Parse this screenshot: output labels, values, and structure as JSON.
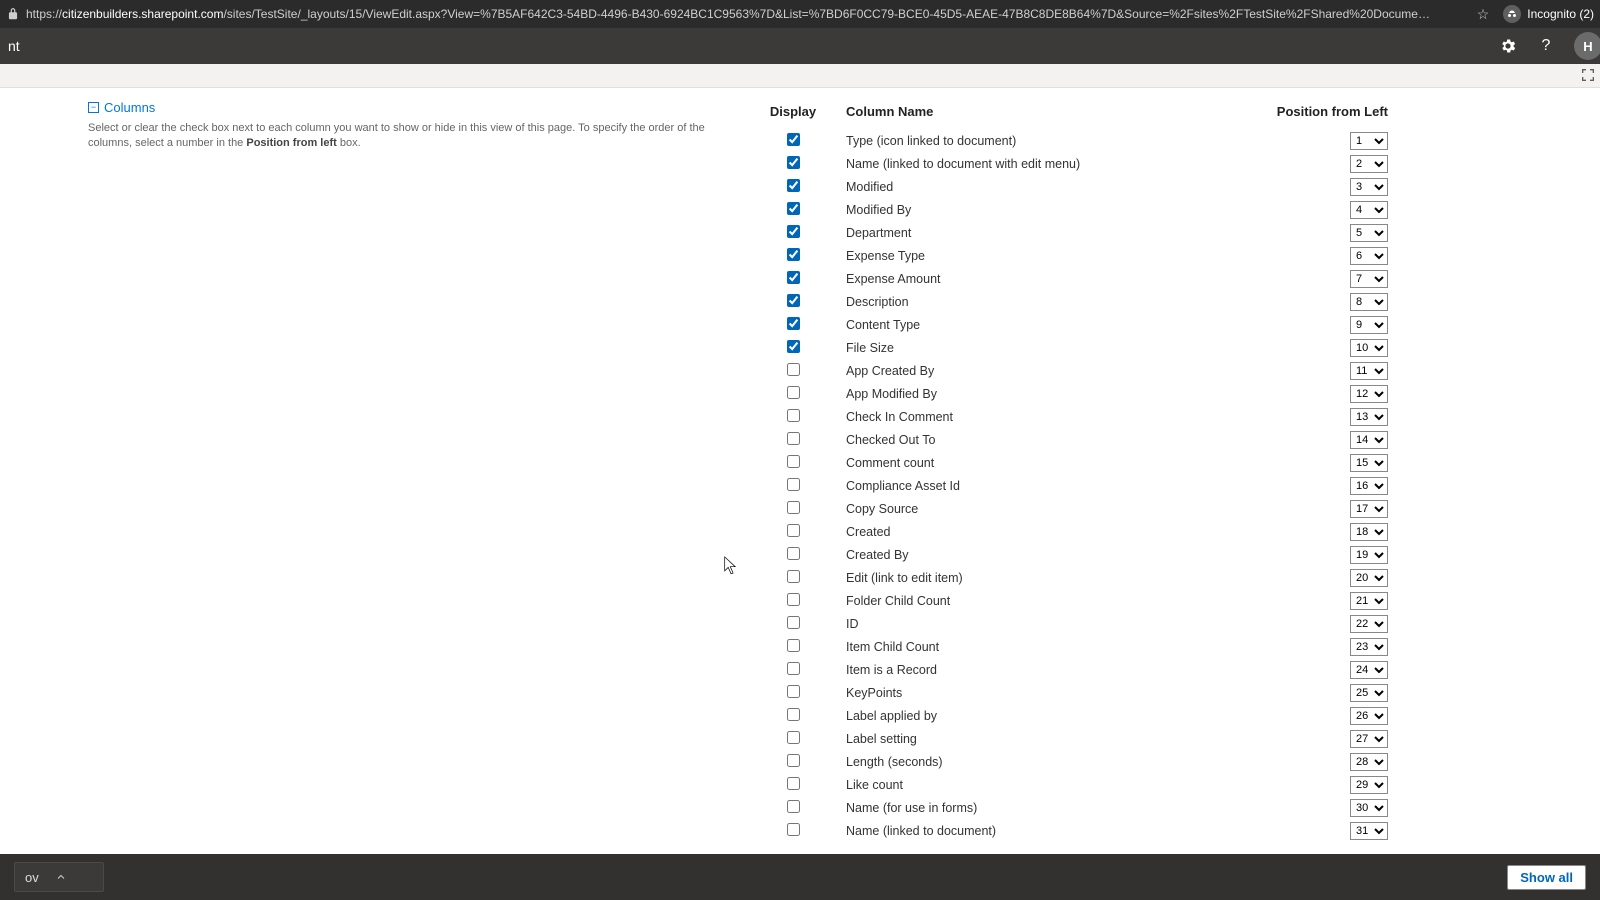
{
  "browser": {
    "url_prefix": "https://",
    "url_host": "citizenbuilders.sharepoint.com",
    "url_path": "/sites/TestSite/_layouts/15/ViewEdit.aspx?View=%7B5AF642C3-54BD-4496-B430-6924BC1C9563%7D&List=%7BD6F0CC79-BCE0-45D5-AEAE-47B8C8DE8B64%7D&Source=%2Fsites%2FTestSite%2FShared%20Docume…",
    "incognito_label": "Incognito (2)"
  },
  "suite": {
    "title_fragment": "nt",
    "avatar_initial": "H"
  },
  "section": {
    "title": "Columns",
    "desc_a": "Select or clear the check box next to each column you want to show or hide in this view of this page. To specify the order of the columns, select a number in the ",
    "desc_bold": "Position from left",
    "desc_b": " box."
  },
  "headers": {
    "display": "Display",
    "name": "Column Name",
    "position": "Position from Left"
  },
  "columns": [
    {
      "checked": true,
      "name": "Type (icon linked to document)",
      "pos": "1"
    },
    {
      "checked": true,
      "name": "Name (linked to document with edit menu)",
      "pos": "2"
    },
    {
      "checked": true,
      "name": "Modified",
      "pos": "3"
    },
    {
      "checked": true,
      "name": "Modified By",
      "pos": "4"
    },
    {
      "checked": true,
      "name": "Department",
      "pos": "5"
    },
    {
      "checked": true,
      "name": "Expense Type",
      "pos": "6"
    },
    {
      "checked": true,
      "name": "Expense Amount",
      "pos": "7"
    },
    {
      "checked": true,
      "name": "Description",
      "pos": "8"
    },
    {
      "checked": true,
      "name": "Content Type",
      "pos": "9"
    },
    {
      "checked": true,
      "name": "File Size",
      "pos": "10"
    },
    {
      "checked": false,
      "name": "App Created By",
      "pos": "11"
    },
    {
      "checked": false,
      "name": "App Modified By",
      "pos": "12"
    },
    {
      "checked": false,
      "name": "Check In Comment",
      "pos": "13"
    },
    {
      "checked": false,
      "name": "Checked Out To",
      "pos": "14"
    },
    {
      "checked": false,
      "name": "Comment count",
      "pos": "15"
    },
    {
      "checked": false,
      "name": "Compliance Asset Id",
      "pos": "16"
    },
    {
      "checked": false,
      "name": "Copy Source",
      "pos": "17"
    },
    {
      "checked": false,
      "name": "Created",
      "pos": "18"
    },
    {
      "checked": false,
      "name": "Created By",
      "pos": "19"
    },
    {
      "checked": false,
      "name": "Edit (link to edit item)",
      "pos": "20"
    },
    {
      "checked": false,
      "name": "Folder Child Count",
      "pos": "21"
    },
    {
      "checked": false,
      "name": "ID",
      "pos": "22"
    },
    {
      "checked": false,
      "name": "Item Child Count",
      "pos": "23"
    },
    {
      "checked": false,
      "name": "Item is a Record",
      "pos": "24"
    },
    {
      "checked": false,
      "name": "KeyPoints",
      "pos": "25"
    },
    {
      "checked": false,
      "name": "Label applied by",
      "pos": "26"
    },
    {
      "checked": false,
      "name": "Label setting",
      "pos": "27"
    },
    {
      "checked": false,
      "name": "Length (seconds)",
      "pos": "28"
    },
    {
      "checked": false,
      "name": "Like count",
      "pos": "29"
    },
    {
      "checked": false,
      "name": "Name (for use in forms)",
      "pos": "30"
    },
    {
      "checked": false,
      "name": "Name (linked to document)",
      "pos": "31"
    }
  ],
  "download": {
    "item_label": "ov",
    "show_all": "Show all"
  }
}
